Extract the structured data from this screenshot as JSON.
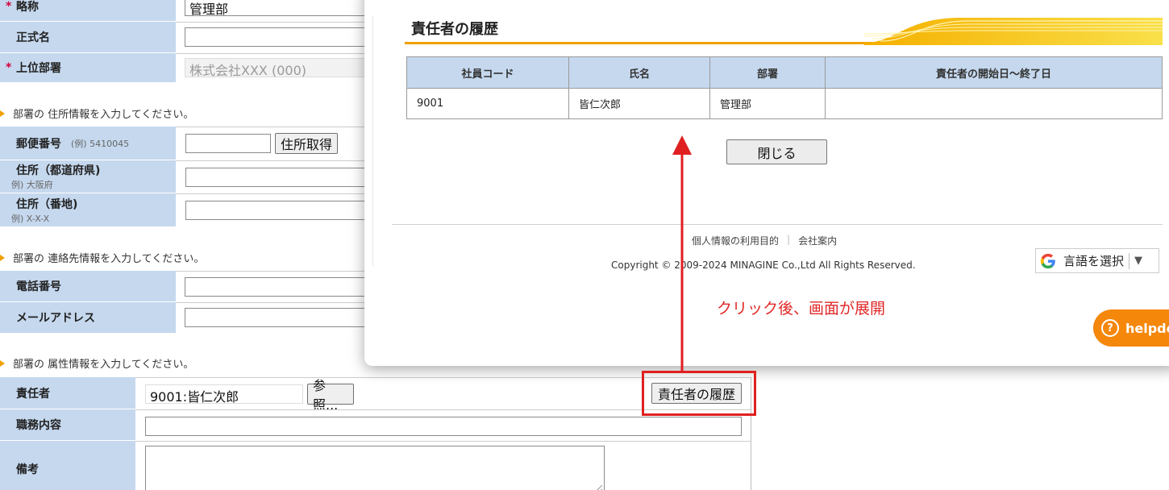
{
  "form": {
    "abbr_label": "略称",
    "abbr_value": "管理部",
    "formal_name_label": "正式名",
    "formal_name_value": "",
    "parent_dept_label": "上位部署",
    "parent_dept_value": "株式会社XXX (000)",
    "required_mark": "*",
    "address_note": "部署の 住所情報を入力してください。",
    "postal_label": "郵便番号",
    "postal_example": "(例) 5410045",
    "postal_value": "",
    "get_address_btn": "住所取得",
    "pref_label": "住所（都道府県)",
    "pref_example": "例) 大阪府",
    "pref_value": "",
    "street_label": "住所（番地)",
    "street_example": "例) X-X-X",
    "street_value": "",
    "contact_note": "部署の 連絡先情報を入力してください。",
    "phone_label": "電話番号",
    "phone_value": "",
    "email_label": "メールアドレス",
    "email_value": "",
    "attr_note": "部署の 属性情報を入力してください。",
    "manager_label": "責任者",
    "manager_value": "9001:皆仁次郎",
    "ref_btn": "参照...",
    "history_btn": "責任者の履歴",
    "duties_label": "職務内容",
    "duties_value": "",
    "remarks_label": "備考",
    "remarks_value": ""
  },
  "modal": {
    "title": "責任者の履歴",
    "columns": [
      "社員コード",
      "氏名",
      "部署",
      "責任者の開始日～終了日"
    ],
    "rows": [
      {
        "code": "9001",
        "name": "皆仁次郎",
        "dept": "管理部",
        "period": ""
      }
    ],
    "close_btn": "閉じる",
    "footer_link_privacy": "個人情報の利用目的",
    "footer_sep": "|",
    "footer_link_company": "会社案内",
    "copyright": "Copyright © 2009-2024 MINAGINE Co.,Ltd All Rights Reserved.",
    "lang_select": "言語を選択",
    "lang_arrow": "▼",
    "helpdesk": "helpdes",
    "helpdesk_icon": "?"
  },
  "annotation": {
    "text": "クリック後、画面が展開",
    "color": "#e02828"
  },
  "colors": {
    "label_bg": "#c5d8ee",
    "accent_orange": "#f5870b",
    "title_bar_yellow": "#f5c518"
  }
}
